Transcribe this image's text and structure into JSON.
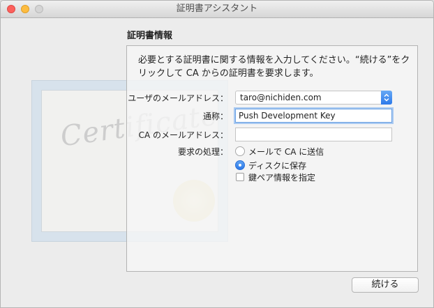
{
  "window": {
    "title": "証明書アシスタント"
  },
  "section_title": "証明書情報",
  "description": "必要とする証明書に関する情報を入力してください。“続ける”をクリックして CA からの証明書を要求します。",
  "certificate_watermark": "Certificate",
  "form": {
    "email_label": "ユーザのメールアドレス：",
    "email_value": "taro@nichiden.com",
    "common_name_label": "通称：",
    "common_name_value": "Push Development Key",
    "ca_email_label": "CA のメールアドレス：",
    "ca_email_value": "",
    "request_label": "要求の処理：",
    "option_email": "メールで CA に送信",
    "option_disk": "ディスクに保存",
    "option_keypair": "鍵ペア情報を指定"
  },
  "continue_button": "続ける",
  "colors": {
    "accent": "#2b78e8",
    "close": "#fc605c",
    "minimize": "#fdbc40"
  }
}
